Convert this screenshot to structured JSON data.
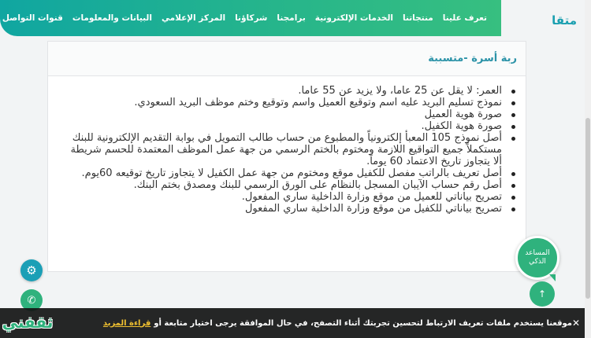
{
  "brand": "متقا",
  "nav": [
    "تعرف علينا",
    "منتجاتنا",
    "الخدمات الإلكترونية",
    "برامجنا",
    "شركاؤنا",
    "المركز الإعلامي",
    "البيانات والمعلومات",
    "قنوات التواصل"
  ],
  "card": {
    "title": "ربة أسرة -متسببة",
    "items": [
      "العمر: لا يقل عن 25 عاما، ولا يزيد عن 55 عاما.",
      "نموذج تسليم البريد عليه اسم وتوقيع العميل واسم وتوقيع وختم موظف البريد السعودي.",
      "صورة هوية العميل",
      "صورة هوية الكفيل.",
      "أصل نموذج 105 المعبأ إلكترونياً والمطبوع من حساب طالب التمويل في بوابة التقديم الإلكترونية للبنك مستكملاً جميع التواقيع اللازمة ومختوم بالختم الرسمي من جهة عمل الموظف المعتمدة للحسم شريطة ألا يتجاوز تاريخ الاعتماد 60 يوماً.",
      "أصل تعريف بالراتب مفصل للكفيل موقع ومختوم من جهة عمل الكفيل لا يتجاوز تاريخ توقيعه 60يوم.",
      "أصل رقم حساب الآيبان المسجل بالنظام على الورق الرسمي للبنك ومصدق بختم البنك.",
      "تصريح بياناتي للعميل من موقع وزارة الداخلية ساري المفعول.",
      "تصريح بياناتي للكفيل من موقع وزارة الداخلية ساري المفعول"
    ]
  },
  "assistant": {
    "line1": "المساعد",
    "line2": "الذكي"
  },
  "cookie": {
    "text": "موقعنا يستخدم ملفات تعريف الارتباط لتحسين تجربتك أثناء التصفح، في حال الموافقة يرجى اختيار متابعة أو",
    "more": "قراءة المزيد"
  },
  "logo_text": "ثقفني",
  "icons": {
    "gear": "gear-icon",
    "phone": "phone-icon",
    "up": "arrow-up-icon",
    "close": "close-icon"
  }
}
